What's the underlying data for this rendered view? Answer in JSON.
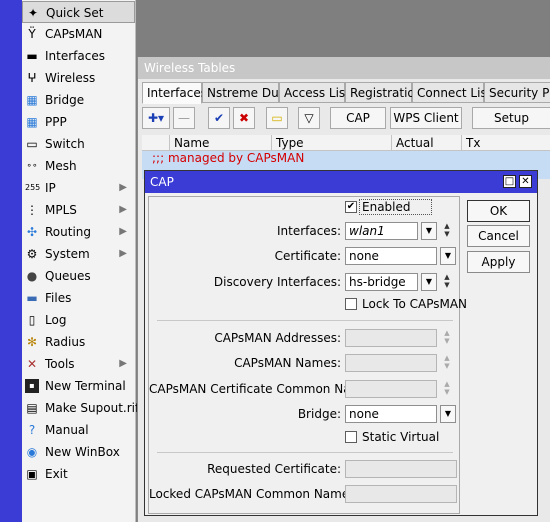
{
  "sidebar": {
    "items": [
      {
        "label": "Quick Set",
        "icon": "wand-icon"
      },
      {
        "label": "CAPsMAN",
        "icon": "antenna-icon"
      },
      {
        "label": "Interfaces",
        "icon": "interfaces-icon"
      },
      {
        "label": "Wireless",
        "icon": "wireless-icon"
      },
      {
        "label": "Bridge",
        "icon": "bridge-icon"
      },
      {
        "label": "PPP",
        "icon": "ppp-icon"
      },
      {
        "label": "Switch",
        "icon": "switch-icon"
      },
      {
        "label": "Mesh",
        "icon": "mesh-icon"
      },
      {
        "label": "IP",
        "icon": "ip-icon"
      },
      {
        "label": "MPLS",
        "icon": "mpls-icon"
      },
      {
        "label": "Routing",
        "icon": "routing-icon"
      },
      {
        "label": "System",
        "icon": "gear-icon"
      },
      {
        "label": "Queues",
        "icon": "queues-icon"
      },
      {
        "label": "Files",
        "icon": "folder-icon"
      },
      {
        "label": "Log",
        "icon": "log-icon"
      },
      {
        "label": "Radius",
        "icon": "radius-icon"
      },
      {
        "label": "Tools",
        "icon": "tools-icon"
      },
      {
        "label": "New Terminal",
        "icon": "terminal-icon"
      },
      {
        "label": "Make Supout.rif",
        "icon": "document-icon"
      },
      {
        "label": "Manual",
        "icon": "help-icon"
      },
      {
        "label": "New WinBox",
        "icon": "winbox-icon"
      },
      {
        "label": "Exit",
        "icon": "exit-icon"
      }
    ]
  },
  "wireless_tables": {
    "title": "Wireless Tables",
    "tabs": [
      "Interfaces",
      "Nstreme Dual",
      "Access List",
      "Registration",
      "Connect List",
      "Security Profi"
    ],
    "toolbar": {
      "cap": "CAP",
      "wps_client": "WPS Client",
      "setup_repeater": "Setup Repeater"
    },
    "columns": [
      "Name",
      "Type",
      "Actual MTU",
      "Tx"
    ],
    "rows": [
      {
        "text": ";;; managed by CAPsMAN"
      }
    ]
  },
  "cap_dialog": {
    "title": "CAP",
    "enabled_label": "Enabled",
    "enabled_checked": true,
    "interfaces_label": "Interfaces:",
    "interfaces_value": "wlan1",
    "certificate_label": "Certificate:",
    "certificate_value": "none",
    "discovery_label": "Discovery Interfaces:",
    "discovery_value": "hs-bridge",
    "lock_label": "Lock To CAPsMAN",
    "lock_checked": false,
    "addresses_label": "CAPsMAN Addresses:",
    "names_label": "CAPsMAN Names:",
    "cert_cn_label": "CAPsMAN Certificate Common Names:",
    "bridge_label": "Bridge:",
    "bridge_value": "none",
    "static_virtual_label": "Static Virtual",
    "static_virtual_checked": false,
    "requested_cert_label": "Requested Certificate:",
    "locked_cn_label": "Locked CAPsMAN Common Name:",
    "buttons": {
      "ok": "OK",
      "cancel": "Cancel",
      "apply": "Apply"
    }
  },
  "colors": {
    "title_blue": "#3b3bd6",
    "managed_red": "#d40000",
    "selection": "#c6dcf5"
  }
}
